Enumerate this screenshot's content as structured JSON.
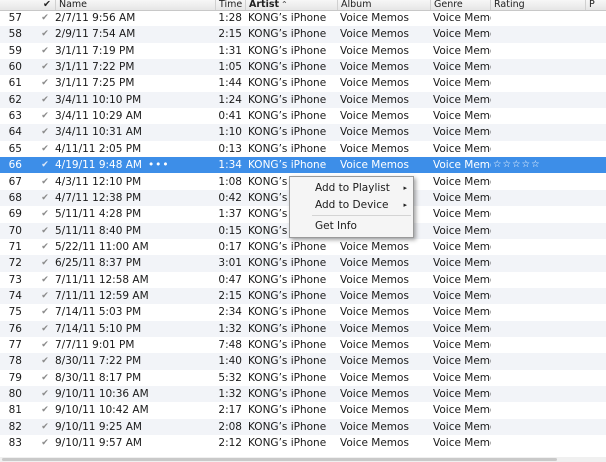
{
  "columns": {
    "check": "✔",
    "name": "Name",
    "time": "Time",
    "artist": "Artist",
    "album": "Album",
    "genre": "Genre",
    "rating": "Rating",
    "extra": "P"
  },
  "rows": [
    {
      "num": "57",
      "name": "2/7/11 9:56 AM",
      "time": "1:28",
      "artist": "KONG’s iPhone",
      "album": "Voice Memos",
      "genre": "Voice Memo"
    },
    {
      "num": "58",
      "name": "2/9/11 7:54 AM",
      "time": "2:15",
      "artist": "KONG’s iPhone",
      "album": "Voice Memos",
      "genre": "Voice Memo"
    },
    {
      "num": "59",
      "name": "3/1/11 7:19 PM",
      "time": "1:31",
      "artist": "KONG’s iPhone",
      "album": "Voice Memos",
      "genre": "Voice Memo"
    },
    {
      "num": "60",
      "name": "3/1/11 7:22 PM",
      "time": "1:05",
      "artist": "KONG’s iPhone",
      "album": "Voice Memos",
      "genre": "Voice Memo"
    },
    {
      "num": "61",
      "name": "3/1/11 7:25 PM",
      "time": "1:44",
      "artist": "KONG’s iPhone",
      "album": "Voice Memos",
      "genre": "Voice Memo"
    },
    {
      "num": "62",
      "name": "3/4/11 10:10 PM",
      "time": "1:24",
      "artist": "KONG’s iPhone",
      "album": "Voice Memos",
      "genre": "Voice Memo"
    },
    {
      "num": "63",
      "name": "3/4/11 10:29 AM",
      "time": "0:41",
      "artist": "KONG’s iPhone",
      "album": "Voice Memos",
      "genre": "Voice Memo"
    },
    {
      "num": "64",
      "name": "3/4/11 10:31 AM",
      "time": "1:10",
      "artist": "KONG’s iPhone",
      "album": "Voice Memos",
      "genre": "Voice Memo"
    },
    {
      "num": "65",
      "name": "4/11/11 2:05 PM",
      "time": "0:13",
      "artist": "KONG’s iPhone",
      "album": "Voice Memos",
      "genre": "Voice Memo"
    },
    {
      "num": "66",
      "name": "4/19/11 9:48 AM",
      "time": "1:34",
      "artist": "KONG’s iPhone",
      "album": "Voice Memos",
      "genre": "Voice Memo",
      "dots": "•••",
      "rating": "☆☆☆☆☆"
    },
    {
      "num": "67",
      "name": "4/3/11 12:10 PM",
      "time": "1:08",
      "artist": "KONG’s iPhone",
      "album": "Voice Memos",
      "genre": "Voice Memo"
    },
    {
      "num": "68",
      "name": "4/7/11 12:38 PM",
      "time": "0:42",
      "artist": "KONG’s iPhone",
      "album": "Voice Memos",
      "genre": "Voice Memo"
    },
    {
      "num": "69",
      "name": "5/11/11 4:28 PM",
      "time": "1:37",
      "artist": "KONG’s iPhone",
      "album": "Voice Memos",
      "genre": "Voice Memo"
    },
    {
      "num": "70",
      "name": "5/11/11 8:40 PM",
      "time": "0:15",
      "artist": "KONG’s iPhone",
      "album": "Voice Memos",
      "genre": "Voice Memo"
    },
    {
      "num": "71",
      "name": "5/22/11 11:00 AM",
      "time": "0:17",
      "artist": "KONG’s iPhone",
      "album": "Voice Memos",
      "genre": "Voice Memo"
    },
    {
      "num": "72",
      "name": "6/25/11 8:37 PM",
      "time": "3:01",
      "artist": "KONG’s iPhone",
      "album": "Voice Memos",
      "genre": "Voice Memo"
    },
    {
      "num": "73",
      "name": "7/11/11 12:58 AM",
      "time": "0:47",
      "artist": "KONG’s iPhone",
      "album": "Voice Memos",
      "genre": "Voice Memo"
    },
    {
      "num": "74",
      "name": "7/11/11 12:59 AM",
      "time": "2:15",
      "artist": "KONG’s iPhone",
      "album": "Voice Memos",
      "genre": "Voice Memo"
    },
    {
      "num": "75",
      "name": "7/14/11 5:03 PM",
      "time": "2:34",
      "artist": "KONG’s iPhone",
      "album": "Voice Memos",
      "genre": "Voice Memo"
    },
    {
      "num": "76",
      "name": "7/14/11 5:10 PM",
      "time": "1:32",
      "artist": "KONG’s iPhone",
      "album": "Voice Memos",
      "genre": "Voice Memo"
    },
    {
      "num": "77",
      "name": "7/7/11 9:01 PM",
      "time": "7:48",
      "artist": "KONG’s iPhone",
      "album": "Voice Memos",
      "genre": "Voice Memo"
    },
    {
      "num": "78",
      "name": "8/30/11 7:22 PM",
      "time": "1:40",
      "artist": "KONG’s iPhone",
      "album": "Voice Memos",
      "genre": "Voice Memo"
    },
    {
      "num": "79",
      "name": "8/30/11 8:17 PM",
      "time": "5:32",
      "artist": "KONG’s iPhone",
      "album": "Voice Memos",
      "genre": "Voice Memo"
    },
    {
      "num": "80",
      "name": "9/10/11 10:36 AM",
      "time": "1:32",
      "artist": "KONG’s iPhone",
      "album": "Voice Memos",
      "genre": "Voice Memo"
    },
    {
      "num": "81",
      "name": "9/10/11 10:42 AM",
      "time": "2:17",
      "artist": "KONG’s iPhone",
      "album": "Voice Memos",
      "genre": "Voice Memo"
    },
    {
      "num": "82",
      "name": "9/10/11 9:25 AM",
      "time": "2:08",
      "artist": "KONG’s iPhone",
      "album": "Voice Memos",
      "genre": "Voice Memo"
    },
    {
      "num": "83",
      "name": "9/10/11 9:57 AM",
      "time": "2:12",
      "artist": "KONG’s iPhone",
      "album": "Voice Memos",
      "genre": "Voice Memo"
    }
  ],
  "selected_row": "66",
  "row_check": "✔",
  "sort_indicator_icon": "chevron-up-icon",
  "context_menu": {
    "items": [
      {
        "label": "Add to Playlist",
        "submenu": true
      },
      {
        "label": "Add to Device",
        "submenu": true
      },
      {
        "label": "Get Info",
        "submenu": false
      }
    ],
    "submenu_arrow": "▸"
  },
  "colors": {
    "selected_row_bg": "#3d8ee8",
    "alt_row_bg": "#f2f4f8",
    "menu_bg": "#f5f5f5"
  }
}
